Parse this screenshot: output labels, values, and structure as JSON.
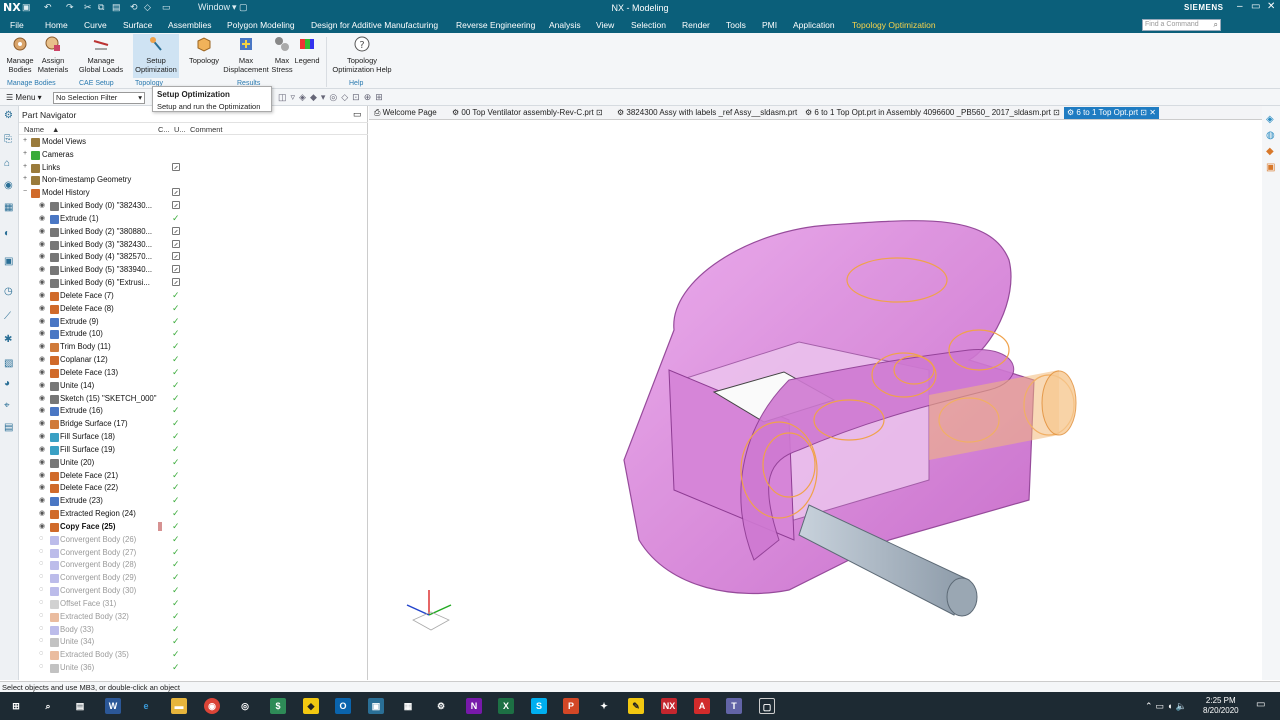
{
  "titlebar": {
    "logo": "NX",
    "window_menu": "Window",
    "title": "NX - Modeling",
    "brand": "SIEMENS"
  },
  "menubar": {
    "items": [
      "File",
      "Home",
      "Curve",
      "Surface",
      "Assemblies",
      "Polygon Modeling",
      "Design for Additive Manufacturing",
      "Reverse Engineering",
      "Analysis",
      "View",
      "Selection",
      "Render",
      "Tools",
      "PMI",
      "Application",
      "Topology Optimization"
    ],
    "active": "Topology Optimization",
    "search_placeholder": "Find a Command"
  },
  "ribbon": {
    "buttons": [
      {
        "label1": "Manage",
        "label2": "Bodies"
      },
      {
        "label1": "Assign",
        "label2": "Materials"
      },
      {
        "label1": "Manage",
        "label2": "Global Loads"
      },
      {
        "label1": "Setup",
        "label2": "Optimization"
      },
      {
        "label1": "Topology",
        "label2": ""
      },
      {
        "label1": "Max",
        "label2": "Displacement"
      },
      {
        "label1": "Max",
        "label2": "Stress"
      },
      {
        "label1": "Legend",
        "label2": ""
      },
      {
        "label1": "Topology",
        "label2": "Optimization Help"
      }
    ],
    "groups": [
      "Manage Bodies",
      "CAE Setup",
      "Topology",
      "Results",
      "Help"
    ]
  },
  "tooltip": {
    "title": "Setup Optimization",
    "description": "Setup and run the Optimization"
  },
  "toolbar": {
    "menu_label": "Menu",
    "selection_filter": "No Selection Filter"
  },
  "navigator": {
    "title": "Part Navigator",
    "columns": [
      "Name",
      "C...",
      "U...",
      "Comment"
    ],
    "rows": [
      {
        "name": "Model Views",
        "level": 0,
        "status": "none",
        "icon": "folder"
      },
      {
        "name": "Cameras",
        "level": 0,
        "status": "none",
        "icon": "check"
      },
      {
        "name": "Links",
        "level": 0,
        "status": "update",
        "icon": "folder"
      },
      {
        "name": "Non-timestamp Geometry",
        "level": 0,
        "status": "none",
        "icon": "folder"
      },
      {
        "name": "Model History",
        "level": 0,
        "status": "update",
        "icon": "history"
      },
      {
        "name": "Linked Body (0) \"382430...",
        "level": 1,
        "status": "update",
        "icon": "link"
      },
      {
        "name": "Extrude (1)",
        "level": 1,
        "status": "check",
        "icon": "extrude"
      },
      {
        "name": "Linked Body (2) \"380880...",
        "level": 1,
        "status": "update",
        "icon": "link"
      },
      {
        "name": "Linked Body (3) \"382430...",
        "level": 1,
        "status": "update",
        "icon": "link"
      },
      {
        "name": "Linked Body (4) \"382570...",
        "level": 1,
        "status": "update",
        "icon": "link"
      },
      {
        "name": "Linked Body (5) \"383940...",
        "level": 1,
        "status": "update",
        "icon": "link"
      },
      {
        "name": "Linked Body (6) \"Extrusi...",
        "level": 1,
        "status": "update",
        "icon": "link"
      },
      {
        "name": "Delete Face (7)",
        "level": 1,
        "status": "check",
        "icon": "delete"
      },
      {
        "name": "Delete Face (8)",
        "level": 1,
        "status": "check",
        "icon": "delete"
      },
      {
        "name": "Extrude (9)",
        "level": 1,
        "status": "check",
        "icon": "extrude"
      },
      {
        "name": "Extrude (10)",
        "level": 1,
        "status": "check",
        "icon": "extrude"
      },
      {
        "name": "Trim Body (11)",
        "level": 1,
        "status": "check",
        "icon": "trim"
      },
      {
        "name": "Coplanar (12)",
        "level": 1,
        "status": "check",
        "icon": "delete"
      },
      {
        "name": "Delete Face (13)",
        "level": 1,
        "status": "check",
        "icon": "delete"
      },
      {
        "name": "Unite (14)",
        "level": 1,
        "status": "check",
        "icon": "unite"
      },
      {
        "name": "Sketch (15) \"SKETCH_000\"",
        "level": 1,
        "status": "check",
        "icon": "sketch"
      },
      {
        "name": "Extrude (16)",
        "level": 1,
        "status": "check",
        "icon": "extrude"
      },
      {
        "name": "Bridge Surface (17)",
        "level": 1,
        "status": "check",
        "icon": "surface"
      },
      {
        "name": "Fill Surface (18)",
        "level": 1,
        "status": "check",
        "icon": "fill"
      },
      {
        "name": "Fill Surface (19)",
        "level": 1,
        "status": "check",
        "icon": "fill"
      },
      {
        "name": "Unite (20)",
        "level": 1,
        "status": "check",
        "icon": "unite"
      },
      {
        "name": "Delete Face (21)",
        "level": 1,
        "status": "check",
        "icon": "delete"
      },
      {
        "name": "Delete Face (22)",
        "level": 1,
        "status": "check",
        "icon": "delete"
      },
      {
        "name": "Extrude (23)",
        "level": 1,
        "status": "check",
        "icon": "extrude"
      },
      {
        "name": "Extracted Region (24)",
        "level": 1,
        "status": "check",
        "icon": "extract"
      },
      {
        "name": "Copy Face (25)",
        "level": 1,
        "status": "check",
        "icon": "delete",
        "bold": true
      },
      {
        "name": "Convergent Body (26)",
        "level": 1,
        "status": "check",
        "icon": "conv",
        "suppressed": true
      },
      {
        "name": "Convergent Body (27)",
        "level": 1,
        "status": "check",
        "icon": "conv",
        "suppressed": true
      },
      {
        "name": "Convergent Body (28)",
        "level": 1,
        "status": "check",
        "icon": "conv",
        "suppressed": true
      },
      {
        "name": "Convergent Body (29)",
        "level": 1,
        "status": "check",
        "icon": "conv",
        "suppressed": true
      },
      {
        "name": "Convergent Body (30)",
        "level": 1,
        "status": "check",
        "icon": "conv",
        "suppressed": true
      },
      {
        "name": "Offset Face (31)",
        "level": 1,
        "status": "check",
        "icon": "offset",
        "suppressed": true
      },
      {
        "name": "Extracted Body (32)",
        "level": 1,
        "status": "check",
        "icon": "extract",
        "suppressed": true
      },
      {
        "name": "Body (33)",
        "level": 1,
        "status": "check",
        "icon": "conv",
        "suppressed": true
      },
      {
        "name": "Unite (34)",
        "level": 1,
        "status": "check",
        "icon": "unite",
        "suppressed": true
      },
      {
        "name": "Extracted Body (35)",
        "level": 1,
        "status": "check",
        "icon": "extract",
        "suppressed": true
      },
      {
        "name": "Unite (36)",
        "level": 1,
        "status": "check",
        "icon": "unite",
        "suppressed": true
      }
    ]
  },
  "tabs": [
    "Welcome Page",
    "00 Top Ventilator assembly-Rev-C.prt",
    "3824300 Assy with labels _ref Assy__sldasm.prt",
    "6 to 1 Top Opt.prt in Assembly 4096600 _PB560_ 2017_sldasm.prt",
    "6 to 1 Top Opt.prt"
  ],
  "status": "Select objects and use MB3, or double-click an object",
  "clock": {
    "time": "2:25 PM",
    "date": "8/20/2020"
  },
  "colors": {
    "title_bg": "#0b5f7a",
    "active_tab": "#1f7cc2",
    "part_pink": "#d57fd6",
    "topology_orange": "#f0a24a",
    "check_green": "#3bab3b"
  }
}
